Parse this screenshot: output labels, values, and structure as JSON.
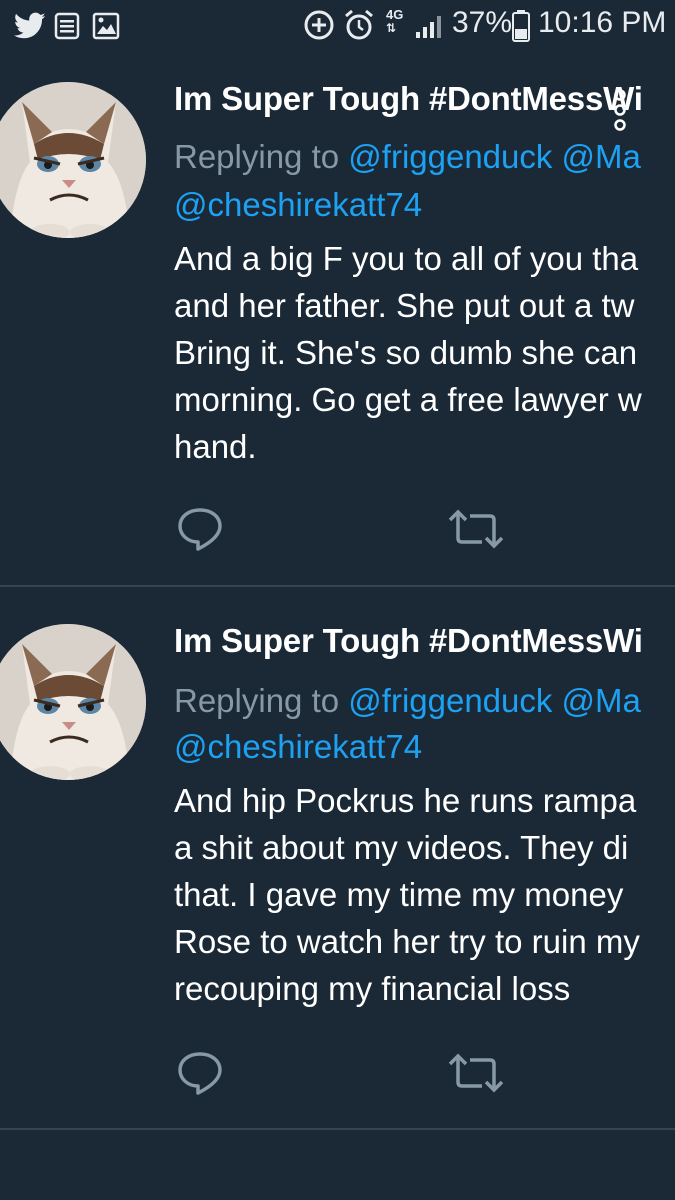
{
  "status_bar": {
    "battery": "37%",
    "time": "10:16 PM",
    "network": "4G",
    "icons": [
      "twitter-icon",
      "messages-icon",
      "gallery-icon",
      "data-saver-icon",
      "alarm-icon",
      "network-4g-icon",
      "signal-icon",
      "battery-icon"
    ]
  },
  "nav": {
    "back_icon": "back-arrow-icon",
    "menu_icon": "overflow-menu-icon"
  },
  "tweets": [
    {
      "name": "Im Super Tough #DontMessWi",
      "replying_prefix": "Replying to",
      "mentions_line1": "@friggenduck @Ma",
      "mentions_line2": "@cheshirekatt74",
      "lines": [
        "And a big F you to all of you tha",
        "and her father. She put out a tw",
        "Bring it. She's so dumb she can",
        "morning. Go get a free lawyer w",
        "hand."
      ]
    },
    {
      "name": "Im Super Tough #DontMessWi",
      "replying_prefix": "Replying to",
      "mentions_line1": "@friggenduck @Ma",
      "mentions_line2": "@cheshirekatt74",
      "lines": [
        "And hip Pockrus he runs rampa",
        "a shit about my videos. They di",
        "that. I gave my time my money",
        "Rose to watch her try to ruin my",
        "recouping my financial loss"
      ]
    }
  ],
  "colors": {
    "background": "#1b2836",
    "accent": "#1da1f2",
    "secondary_text": "#8899a6",
    "divider": "#38444d"
  }
}
